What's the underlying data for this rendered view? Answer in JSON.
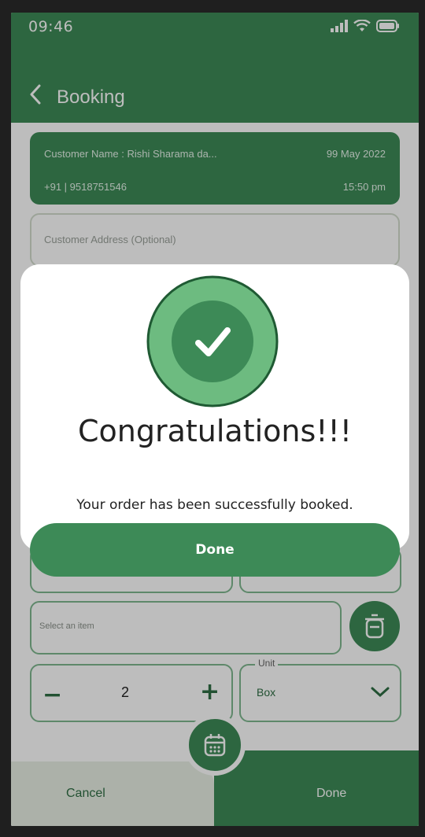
{
  "status_bar": {
    "time": "09:46"
  },
  "header": {
    "title": "Booking"
  },
  "customer": {
    "name_line": "Customer Name : Rishi Sharama da...",
    "date": "99 May 2022",
    "phone": "+91 | 9518751546",
    "time": "15:50 pm"
  },
  "address": {
    "placeholder": "Customer Address (Optional)"
  },
  "item": {
    "placeholder": "Select an item"
  },
  "quantity": {
    "minus": "−",
    "value": "2",
    "plus": "+"
  },
  "unit": {
    "label": "Unit",
    "value": "Box"
  },
  "bottom_bar": {
    "cancel_label": "Cancel",
    "done_label": "Done"
  },
  "dialog": {
    "title": "Congratulations!!!",
    "message": "Your order has been successfully booked.",
    "button_label": "Done"
  },
  "colors": {
    "brand_green": "#3d8a57",
    "light_green": "#6dbb80",
    "dark_outline": "#1f5a33"
  }
}
